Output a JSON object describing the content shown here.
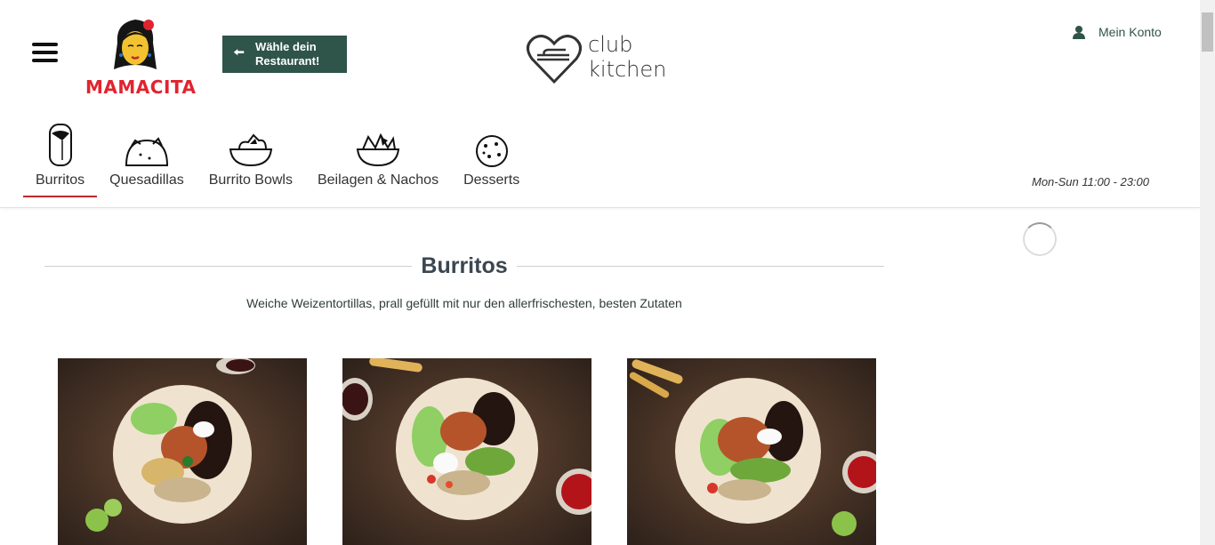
{
  "header": {
    "brand": "MAMACITA",
    "choose_restaurant": "Wähle dein\nRestaurant!",
    "partner_logo": "club\nkitchen",
    "account_label": "Mein Konto",
    "hours": "Mon-Sun 11:00 - 23:00"
  },
  "nav": [
    {
      "label": "Burritos",
      "icon": "burrito-icon",
      "active": true
    },
    {
      "label": "Quesadillas",
      "icon": "quesadilla-icon"
    },
    {
      "label": "Burrito Bowls",
      "icon": "bowl-icon"
    },
    {
      "label": "Beilagen & Nachos",
      "icon": "nachos-icon"
    },
    {
      "label": "Desserts",
      "icon": "cookie-icon"
    }
  ],
  "section": {
    "title": "Burritos",
    "subtitle": "Weiche Weizentortillas, prall gefüllt mit nur den allerfrischesten, besten Zutaten"
  },
  "colors": {
    "brand_red": "#e0242f",
    "button_green": "#2f5449",
    "active_underline": "#c0272d"
  }
}
